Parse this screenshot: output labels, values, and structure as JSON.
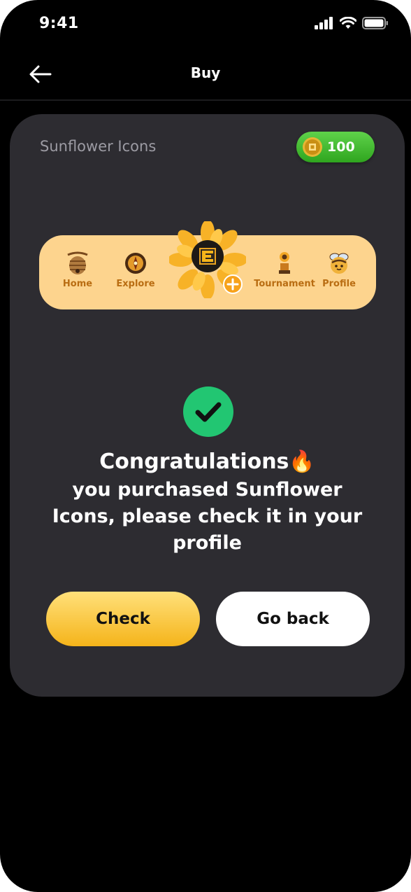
{
  "status_bar": {
    "time": "9:41"
  },
  "nav": {
    "title": "Buy"
  },
  "card": {
    "title": "Sunflower Icons",
    "coin_balance": "100"
  },
  "preview_tabs": [
    {
      "label": "Home",
      "icon": "beehive-icon"
    },
    {
      "label": "Explore",
      "icon": "compass-icon"
    },
    {
      "label": "Tournament",
      "icon": "trophy-sunflower-icon"
    },
    {
      "label": "Profile",
      "icon": "bee-icon"
    }
  ],
  "message": {
    "title": "Congratulations🔥",
    "body": "you purchased Sunflower Icons, please check it in your profile"
  },
  "buttons": {
    "check": "Check",
    "go_back": "Go back"
  },
  "colors": {
    "background": "#000000",
    "card": "#2d2c31",
    "accent_yellow": "#f5b41a",
    "success_green": "#22c672",
    "coin_green": "#2fa51f",
    "tab_label": "#b96d12"
  }
}
